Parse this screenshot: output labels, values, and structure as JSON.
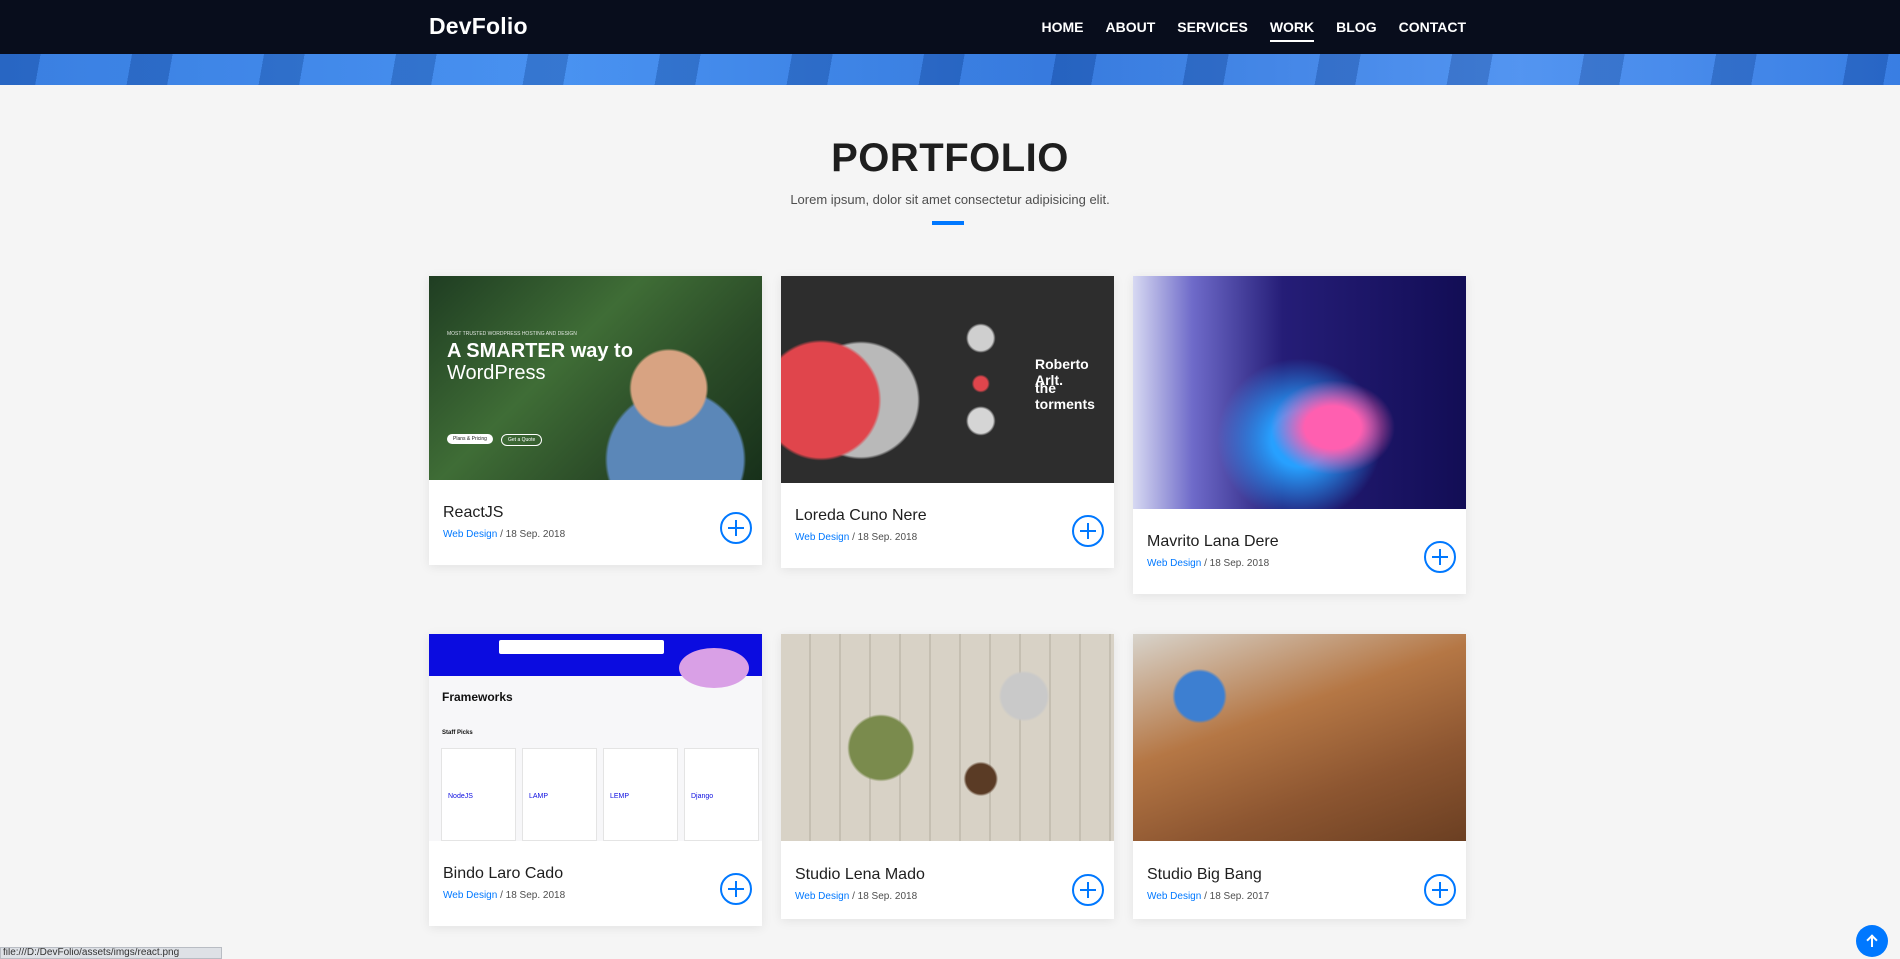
{
  "brand": "DevFolio",
  "nav": [
    "HOME",
    "ABOUT",
    "SERVICES",
    "WORK",
    "BLOG",
    "CONTACT"
  ],
  "active_nav": "WORK",
  "section": {
    "title": "PORTFOLIO",
    "subtitle": "Lorem ipsum, dolor sit amet consectetur adipisicing elit."
  },
  "works": [
    {
      "name": "ReactJS",
      "category": "Web Design",
      "date": " / 18 Sep. 2018",
      "img_text": {
        "kicker": "MOST TRUSTED WORDPRESS HOSTING AND DESIGN",
        "headline": "A SMARTER way to",
        "headline2": "WordPress",
        "btn1": "Plans & Pricing",
        "btn2": "Get a Quote"
      }
    },
    {
      "name": "Loreda Cuno Nere",
      "category": "Web Design",
      "date": " / 18 Sep. 2018",
      "img_text": {
        "headline": "Roberto Arlt.",
        "headline2": "the torments"
      }
    },
    {
      "name": "Mavrito Lana Dere",
      "category": "Web Design",
      "date": " / 18 Sep. 2018"
    },
    {
      "name": "Bindo Laro Cado",
      "category": "Web Design",
      "date": " / 18 Sep. 2018",
      "img_text": {
        "heading": "Frameworks",
        "staff": "Staff Picks",
        "tiles": [
          "NodeJS",
          "LAMP",
          "LEMP",
          "Django"
        ]
      }
    },
    {
      "name": "Studio Lena Mado",
      "category": "Web Design",
      "date": " / 18 Sep. 2018"
    },
    {
      "name": "Studio Big Bang",
      "category": "Web Design",
      "date": " / 18 Sep. 2017"
    }
  ],
  "status_url": "file:///D:/DevFolio/assets/imgs/react.png",
  "colors": {
    "accent": "#0078ff",
    "navbar": "#080d1c",
    "background": "#f5f5f5"
  },
  "icons": {
    "card_action": "plus-circle-icon",
    "scroll": "arrow-up-icon"
  }
}
